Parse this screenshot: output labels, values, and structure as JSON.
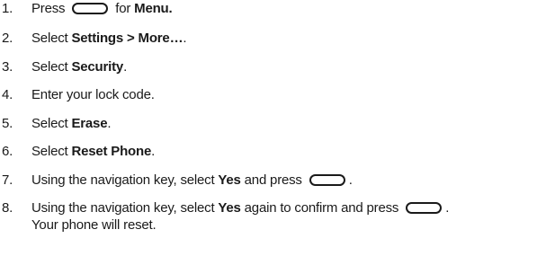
{
  "steps": [
    {
      "num": "1.",
      "before": "Press",
      "key": "soft-key",
      "after": "for",
      "bold": "Menu."
    },
    {
      "num": "2.",
      "before": "Select",
      "bold": "Settings > More…",
      "after": "."
    },
    {
      "num": "3.",
      "before": "Select",
      "bold": "Security",
      "after": "."
    },
    {
      "num": "4.",
      "text": "Enter your lock code."
    },
    {
      "num": "5.",
      "before": "Select",
      "bold": "Erase",
      "after": "."
    },
    {
      "num": "6.",
      "before": "Select",
      "bold": "Reset Phone",
      "after": "."
    },
    {
      "num": "7.",
      "before": "Using the navigation key, select",
      "bold": "Yes",
      "middle": "and press",
      "key": "soft-key",
      "after": "."
    },
    {
      "num": "8.",
      "before": "Using the navigation key, select",
      "bold": "Yes",
      "middle": "again to confirm and press",
      "key": "soft-key",
      "after": ".",
      "line2": "Your phone will reset."
    }
  ]
}
